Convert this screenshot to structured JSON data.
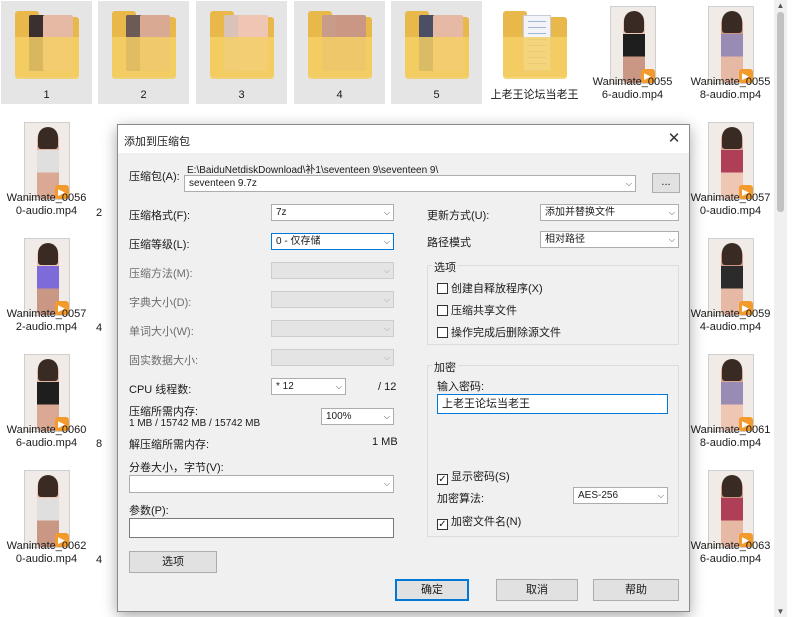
{
  "explorer": {
    "tiles": [
      {
        "label": "1",
        "kind": "folder"
      },
      {
        "label": "2",
        "kind": "folder"
      },
      {
        "label": "3",
        "kind": "folder"
      },
      {
        "label": "4",
        "kind": "folder"
      },
      {
        "label": "5",
        "kind": "folder"
      },
      {
        "label": "上老王论坛当老王",
        "kind": "folder-doc"
      },
      {
        "label": "Wanimate_0055 6-audio.mp4",
        "kind": "video"
      },
      {
        "label": "Wanimate_0055 8-audio.mp4",
        "kind": "video"
      },
      {
        "label": "Wanimate_0056 0-audio.mp4",
        "kind": "video"
      },
      {
        "label": "Wanimate_0057 0-audio.mp4",
        "kind": "video"
      },
      {
        "label": "Wanimate_0057 2-audio.mp4",
        "kind": "video"
      },
      {
        "label": "Wanimate_0059 4-audio.mp4",
        "kind": "video"
      },
      {
        "label": "Wanimate_0060 6-audio.mp4",
        "kind": "video"
      },
      {
        "label": "Wanimate_0061 8-audio.mp4",
        "kind": "video"
      },
      {
        "label": "Wanimate_0062 0-audio.mp4",
        "kind": "video"
      },
      {
        "label": "Wanimate_0063 6-audio.mp4",
        "kind": "video"
      }
    ],
    "partial_labels": [
      "2",
      "4",
      "8",
      "4"
    ],
    "play_glyph": "▶"
  },
  "dialog": {
    "title": "添加到压缩包",
    "close_glyph": "✕",
    "archive_label": "压缩包(A):",
    "archive_path": "E:\\BaiduNetdiskDownload\\补1\\seventeen 9\\seventeen 9\\",
    "archive_name": "seventeen 9.7z",
    "browse_label": "...",
    "left": {
      "format_label": "压缩格式(F):",
      "format_value": "7z",
      "level_label": "压缩等级(L):",
      "level_value": "0 - 仅存储",
      "method_label": "压缩方法(M):",
      "dict_label": "字典大小(D):",
      "word_label": "单词大小(W):",
      "solid_label": "固实数据大小:",
      "threads_label": "CPU 线程数:",
      "threads_value": "* 12",
      "threads_total": "/ 12",
      "mem_comp_label": "压缩所需内存:",
      "mem_comp_detail": "1 MB / 15742 MB / 15742 MB",
      "mem_percent": "100%",
      "mem_decomp_label": "解压缩所需内存:",
      "mem_decomp_value": "1 MB",
      "volume_label": "分卷大小，字节(V):",
      "volume_value": "",
      "params_label": "参数(P):",
      "params_value": "",
      "options_button": "选项"
    },
    "right": {
      "update_label": "更新方式(U):",
      "update_value": "添加并替换文件",
      "path_label": "路径模式",
      "path_value": "相对路径",
      "options_group": "选项",
      "opt_sfx": "创建自释放程序(X)",
      "opt_shared": "压缩共享文件",
      "opt_delete": "操作完成后删除源文件",
      "encrypt_group": "加密",
      "password_label": "输入密码:",
      "password_value": "上老王论坛当老王",
      "show_password": "显示密码(S)",
      "method_label": "加密算法:",
      "method_value": "AES-256",
      "encrypt_names": "加密文件名(N)",
      "check_glyph": "✓"
    },
    "buttons": {
      "ok": "确定",
      "cancel": "取消",
      "help": "帮助"
    },
    "arrow_glyph": "⌵"
  }
}
